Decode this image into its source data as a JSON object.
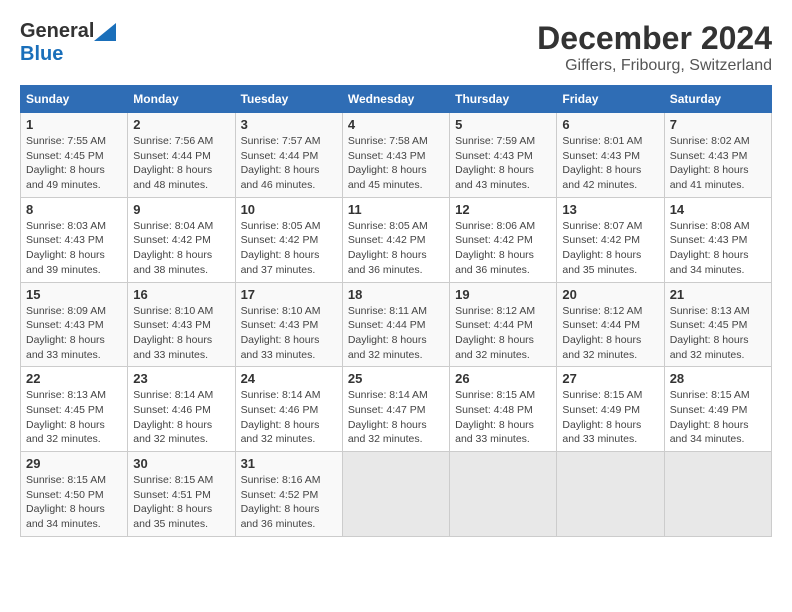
{
  "header": {
    "logo_general": "General",
    "logo_blue": "Blue",
    "title": "December 2024",
    "subtitle": "Giffers, Fribourg, Switzerland"
  },
  "calendar": {
    "days_of_week": [
      "Sunday",
      "Monday",
      "Tuesday",
      "Wednesday",
      "Thursday",
      "Friday",
      "Saturday"
    ],
    "weeks": [
      [
        {
          "day": "1",
          "sunrise": "7:55 AM",
          "sunset": "4:45 PM",
          "daylight": "8 hours and 49 minutes."
        },
        {
          "day": "2",
          "sunrise": "7:56 AM",
          "sunset": "4:44 PM",
          "daylight": "8 hours and 48 minutes."
        },
        {
          "day": "3",
          "sunrise": "7:57 AM",
          "sunset": "4:44 PM",
          "daylight": "8 hours and 46 minutes."
        },
        {
          "day": "4",
          "sunrise": "7:58 AM",
          "sunset": "4:43 PM",
          "daylight": "8 hours and 45 minutes."
        },
        {
          "day": "5",
          "sunrise": "7:59 AM",
          "sunset": "4:43 PM",
          "daylight": "8 hours and 43 minutes."
        },
        {
          "day": "6",
          "sunrise": "8:01 AM",
          "sunset": "4:43 PM",
          "daylight": "8 hours and 42 minutes."
        },
        {
          "day": "7",
          "sunrise": "8:02 AM",
          "sunset": "4:43 PM",
          "daylight": "8 hours and 41 minutes."
        }
      ],
      [
        {
          "day": "8",
          "sunrise": "8:03 AM",
          "sunset": "4:43 PM",
          "daylight": "8 hours and 39 minutes."
        },
        {
          "day": "9",
          "sunrise": "8:04 AM",
          "sunset": "4:42 PM",
          "daylight": "8 hours and 38 minutes."
        },
        {
          "day": "10",
          "sunrise": "8:05 AM",
          "sunset": "4:42 PM",
          "daylight": "8 hours and 37 minutes."
        },
        {
          "day": "11",
          "sunrise": "8:05 AM",
          "sunset": "4:42 PM",
          "daylight": "8 hours and 36 minutes."
        },
        {
          "day": "12",
          "sunrise": "8:06 AM",
          "sunset": "4:42 PM",
          "daylight": "8 hours and 36 minutes."
        },
        {
          "day": "13",
          "sunrise": "8:07 AM",
          "sunset": "4:42 PM",
          "daylight": "8 hours and 35 minutes."
        },
        {
          "day": "14",
          "sunrise": "8:08 AM",
          "sunset": "4:43 PM",
          "daylight": "8 hours and 34 minutes."
        }
      ],
      [
        {
          "day": "15",
          "sunrise": "8:09 AM",
          "sunset": "4:43 PM",
          "daylight": "8 hours and 33 minutes."
        },
        {
          "day": "16",
          "sunrise": "8:10 AM",
          "sunset": "4:43 PM",
          "daylight": "8 hours and 33 minutes."
        },
        {
          "day": "17",
          "sunrise": "8:10 AM",
          "sunset": "4:43 PM",
          "daylight": "8 hours and 33 minutes."
        },
        {
          "day": "18",
          "sunrise": "8:11 AM",
          "sunset": "4:44 PM",
          "daylight": "8 hours and 32 minutes."
        },
        {
          "day": "19",
          "sunrise": "8:12 AM",
          "sunset": "4:44 PM",
          "daylight": "8 hours and 32 minutes."
        },
        {
          "day": "20",
          "sunrise": "8:12 AM",
          "sunset": "4:44 PM",
          "daylight": "8 hours and 32 minutes."
        },
        {
          "day": "21",
          "sunrise": "8:13 AM",
          "sunset": "4:45 PM",
          "daylight": "8 hours and 32 minutes."
        }
      ],
      [
        {
          "day": "22",
          "sunrise": "8:13 AM",
          "sunset": "4:45 PM",
          "daylight": "8 hours and 32 minutes."
        },
        {
          "day": "23",
          "sunrise": "8:14 AM",
          "sunset": "4:46 PM",
          "daylight": "8 hours and 32 minutes."
        },
        {
          "day": "24",
          "sunrise": "8:14 AM",
          "sunset": "4:46 PM",
          "daylight": "8 hours and 32 minutes."
        },
        {
          "day": "25",
          "sunrise": "8:14 AM",
          "sunset": "4:47 PM",
          "daylight": "8 hours and 32 minutes."
        },
        {
          "day": "26",
          "sunrise": "8:15 AM",
          "sunset": "4:48 PM",
          "daylight": "8 hours and 33 minutes."
        },
        {
          "day": "27",
          "sunrise": "8:15 AM",
          "sunset": "4:49 PM",
          "daylight": "8 hours and 33 minutes."
        },
        {
          "day": "28",
          "sunrise": "8:15 AM",
          "sunset": "4:49 PM",
          "daylight": "8 hours and 34 minutes."
        }
      ],
      [
        {
          "day": "29",
          "sunrise": "8:15 AM",
          "sunset": "4:50 PM",
          "daylight": "8 hours and 34 minutes."
        },
        {
          "day": "30",
          "sunrise": "8:15 AM",
          "sunset": "4:51 PM",
          "daylight": "8 hours and 35 minutes."
        },
        {
          "day": "31",
          "sunrise": "8:16 AM",
          "sunset": "4:52 PM",
          "daylight": "8 hours and 36 minutes."
        },
        null,
        null,
        null,
        null
      ]
    ],
    "sunrise_label": "Sunrise:",
    "sunset_label": "Sunset:",
    "daylight_label": "Daylight:"
  }
}
